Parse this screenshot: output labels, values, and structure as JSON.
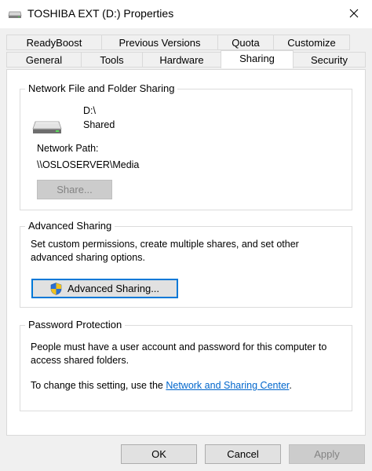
{
  "window": {
    "title": "TOSHIBA EXT (D:) Properties",
    "icon": "drive-icon",
    "close_icon": "close-icon"
  },
  "tabs": {
    "row1": [
      "ReadyBoost",
      "Previous Versions",
      "Quota",
      "Customize"
    ],
    "row2": [
      "General",
      "Tools",
      "Hardware",
      "Sharing",
      "Security"
    ],
    "active": "Sharing"
  },
  "network_sharing": {
    "legend": "Network File and Folder Sharing",
    "drive_name": "D:\\",
    "status": "Shared",
    "path_label": "Network Path:",
    "path_value": "\\\\OSLOSERVER\\Media",
    "share_button": "Share..."
  },
  "advanced_sharing": {
    "legend": "Advanced Sharing",
    "description_line1": "Set custom permissions, create multiple shares, and set other",
    "description_line2": "advanced sharing options.",
    "button": "Advanced Sharing...",
    "button_icon": "uac-shield-icon"
  },
  "password_protection": {
    "legend": "Password Protection",
    "description_line1": "People must have a user account and password for this computer to",
    "description_line2": "access shared folders.",
    "change_prefix": "To change this setting, use the ",
    "change_link": "Network and Sharing Center",
    "change_suffix": "."
  },
  "footer": {
    "ok": "OK",
    "cancel": "Cancel",
    "apply": "Apply"
  },
  "colors": {
    "accent": "#0078d7",
    "link": "#0066cc",
    "disabled_text": "#838383"
  }
}
